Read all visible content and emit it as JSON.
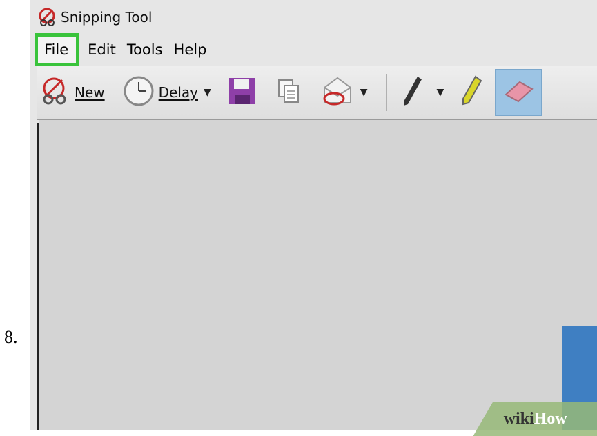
{
  "step": {
    "number": "8."
  },
  "window": {
    "title": "Snipping Tool"
  },
  "menu": [
    {
      "label": "File",
      "highlighted": true
    },
    {
      "label": "Edit",
      "highlighted": false
    },
    {
      "label": "Tools",
      "highlighted": false
    },
    {
      "label": "Help",
      "highlighted": false
    }
  ],
  "toolbar": {
    "new_label": "New",
    "delay_label": "Delay"
  },
  "watermark": {
    "part1": "wiki",
    "part2": "How"
  },
  "colors": {
    "highlight": "#39c33b",
    "canvas": "#d4d4d4",
    "accent_blue": "#3f7fc2"
  }
}
